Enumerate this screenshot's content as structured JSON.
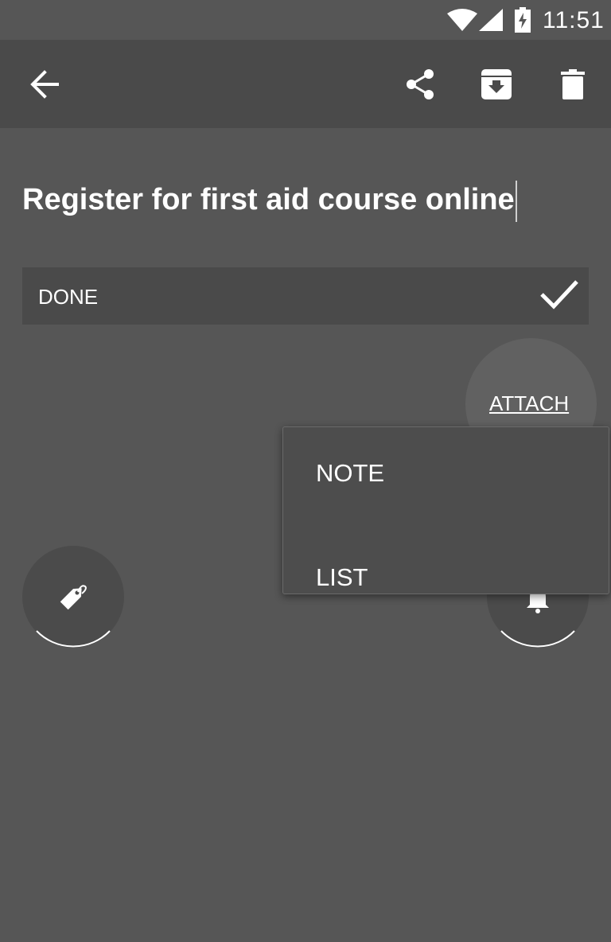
{
  "status_bar": {
    "time": "11:51",
    "icons": [
      "wifi-icon",
      "signal-icon",
      "battery-charging-icon"
    ]
  },
  "toolbar": {
    "icons": [
      "back-arrow-icon",
      "share-icon",
      "archive-icon",
      "delete-icon"
    ]
  },
  "note": {
    "title": "Register for first aid course online",
    "done_label": "DONE"
  },
  "attach": {
    "label": "ATTACH"
  },
  "menu": {
    "items": [
      {
        "label": "NOTE"
      },
      {
        "label": "LIST"
      }
    ]
  },
  "actions": {
    "icons": [
      "tag-icon",
      "bell-icon"
    ]
  },
  "colors": {
    "background": "#565656",
    "toolbar": "#4a4a4a",
    "text": "#ffffff"
  }
}
